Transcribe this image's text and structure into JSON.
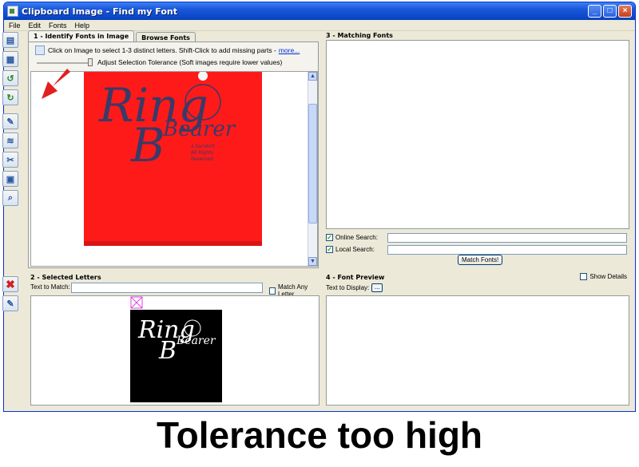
{
  "window": {
    "title": "Clipboard Image - Find my Font",
    "min": "_",
    "max": "□",
    "close": "×"
  },
  "menu": [
    "File",
    "Edit",
    "Fonts",
    "Help"
  ],
  "tabs": [
    "1 - Identify Fonts in Image",
    "Browse Fonts"
  ],
  "identify": {
    "hint": "Click on Image to select 1-3 distinct letters. Shift-Click to add missing parts -",
    "more": "more...",
    "tolerance_label": "Adjust Selection Tolerance (Soft images require lower values)",
    "tolerance_level": 0.93,
    "image_text_1": "Ring",
    "image_text_2": "Bearer",
    "image_sub": "a Sanskrit",
    "image_sub2": "All Rights",
    "image_sub3": "Reserved"
  },
  "matching": {
    "title": "3 - Matching Fonts",
    "online_label": "Online Search:",
    "local_label": "Local Search:",
    "match_button": "Match Fonts!"
  },
  "selected": {
    "title": "2 - Selected Letters",
    "text_to_match": "Text to Match:",
    "match_any": "Match Any Letter",
    "img_text_1": "Ring",
    "img_text_2": "Bearer"
  },
  "preview": {
    "title": "4 - Font Preview",
    "show_details": "Show Details",
    "text_to_display": "Text to Display:",
    "dots": "..."
  },
  "caption": "Tolerance too high",
  "colors": {
    "red_image": "#ff1a1a",
    "title_blue": "#0846c8",
    "arrow": "#e02020"
  }
}
